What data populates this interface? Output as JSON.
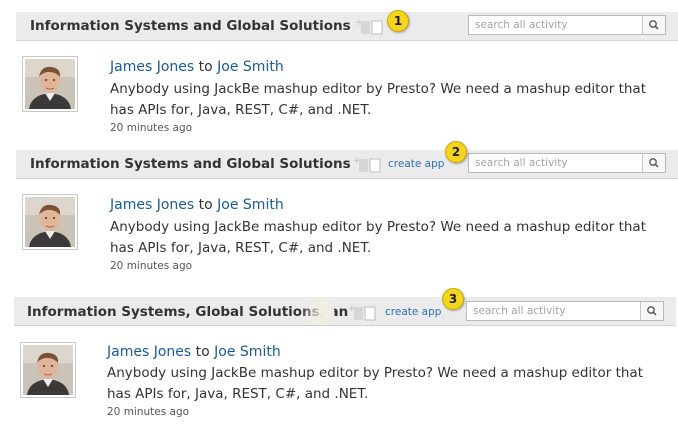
{
  "sections": [
    {
      "title": "Information Systems and Global Solutions",
      "search_placeholder": "search all activity",
      "badge": "1",
      "post": {
        "author": "James Jones",
        "to": "to",
        "recipient": "Joe Smith",
        "text": "Anybody using JackBe mashup editor by Presto? We need a mashup editor that has APIs for, Java, REST, C#, and .NET.",
        "time": "20 minutes ago"
      }
    },
    {
      "title": "Information Systems and Global Solutions",
      "create_app": "create app",
      "search_placeholder": "search all activity",
      "badge": "2",
      "post": {
        "author": "James Jones",
        "to": "to",
        "recipient": "Joe Smith",
        "text": "Anybody using JackBe mashup editor by Presto? We need a mashup editor that has APIs for, Java, REST, C#, and .NET.",
        "time": "20 minutes ago"
      }
    },
    {
      "title": "Information Systems, Global Solutions, an",
      "create_app": "create app",
      "search_placeholder": "search all activity",
      "badge": "3",
      "post": {
        "author": "James Jones",
        "to": "to",
        "recipient": "Joe Smith",
        "text": "Anybody using JackBe mashup editor by Presto? We need a mashup editor that has APIs for, Java, REST, C#, and .NET.",
        "time": "20 minutes ago"
      }
    }
  ],
  "icons": {
    "add_app": "add-app-icon",
    "search": "magnifier-icon",
    "avatar": "user-photo"
  },
  "colors": {
    "link": "#175a9a",
    "bar_bg": "#ebebeb",
    "badge": "#f3d51e"
  }
}
